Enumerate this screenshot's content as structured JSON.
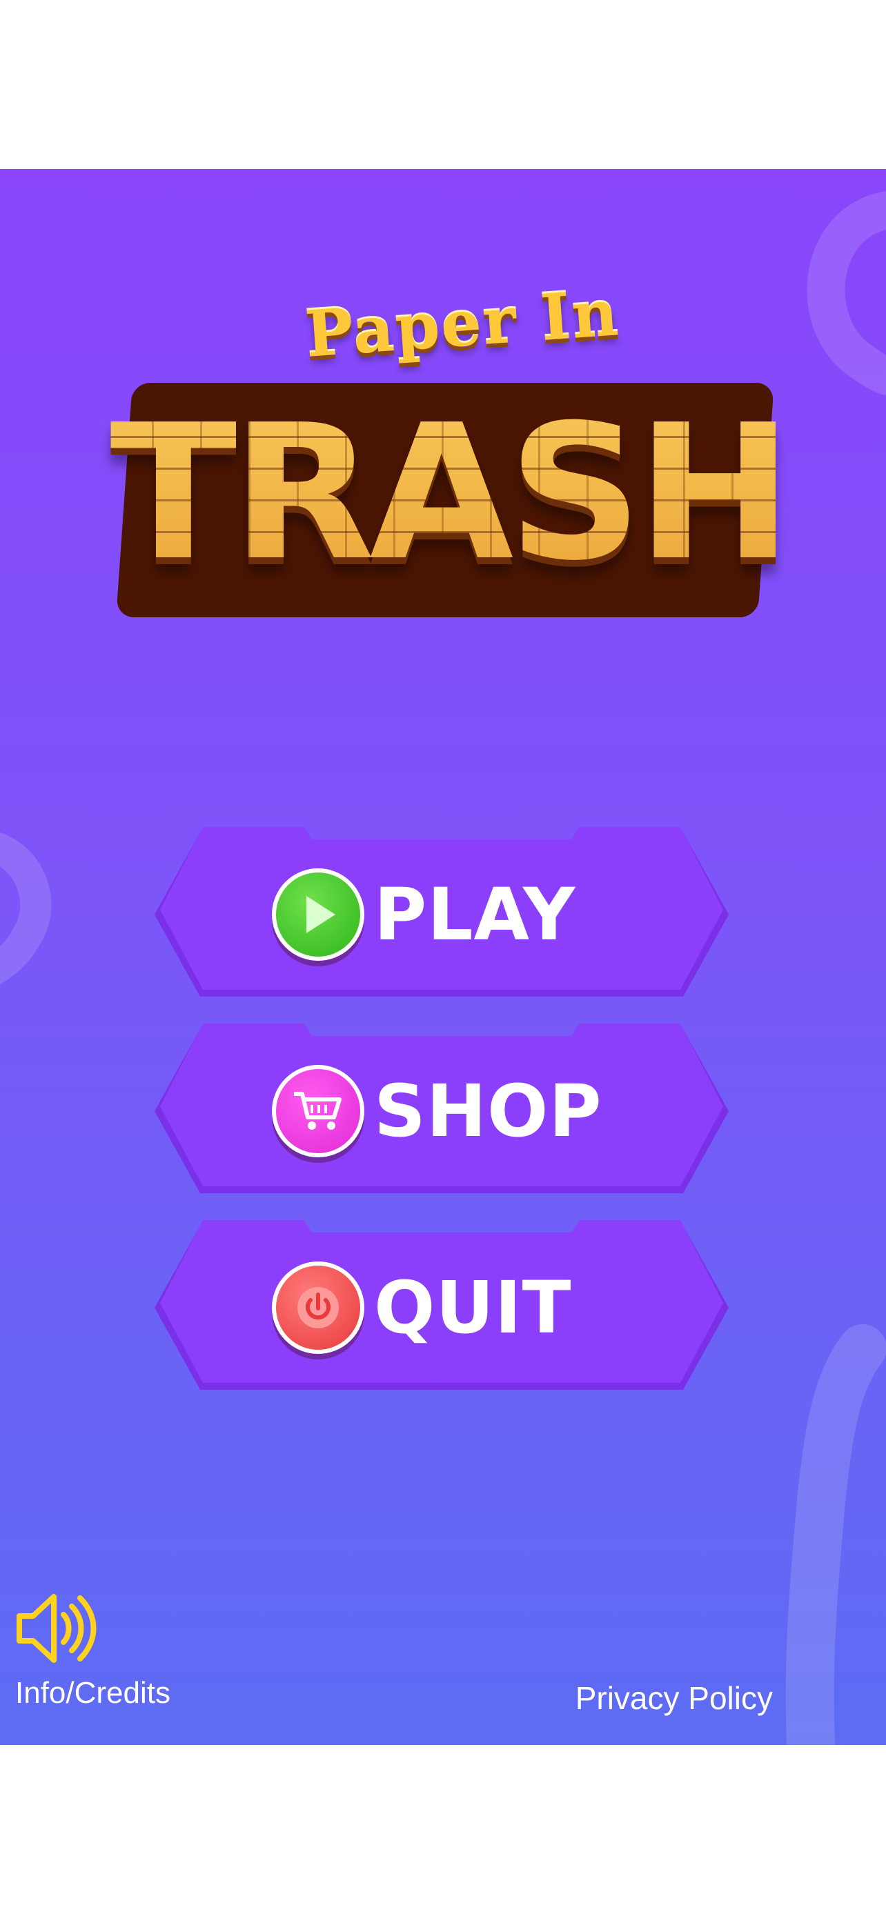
{
  "logo": {
    "subtitle": "Paper In",
    "title": "TRASH"
  },
  "menu": {
    "play_label": "PLAY",
    "shop_label": "SHOP",
    "quit_label": "QUIT"
  },
  "footer": {
    "info_label": "Info/Credits",
    "privacy_label": "Privacy Policy"
  },
  "icons": {
    "play": "play-icon",
    "shop": "cart-icon",
    "quit": "power-icon",
    "sound": "speaker-icon"
  },
  "colors": {
    "background_top": "#8a45fb",
    "background_bottom": "#5d6cf3",
    "button": "#8b3ffa",
    "play_icon": "#3cc52a",
    "shop_icon": "#f040e6",
    "quit_icon": "#ef4a4a",
    "logo": "#f0b23c",
    "speaker": "#ffd21e"
  }
}
